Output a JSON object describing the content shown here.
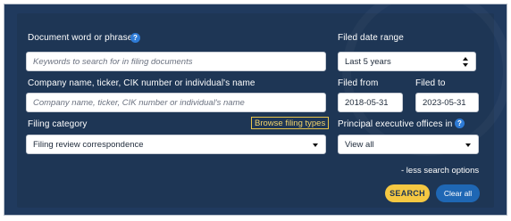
{
  "form": {
    "document_label": "Document word or phrase",
    "document_placeholder": "Keywords to search for in filing documents",
    "company_label": "Company name, ticker, CIK number or individual's name",
    "company_placeholder": "Company name, ticker, CIK number or individual's name",
    "category_label": "Filing category",
    "browse_label": "Browse filing types",
    "category_value": "Filing review correspondence",
    "date_range_label": "Filed date range",
    "date_range_value": "Last 5 years",
    "filed_from_label": "Filed from",
    "filed_from_value": "2018-05-31",
    "filed_to_label": "Filed to",
    "filed_to_value": "2023-05-31",
    "offices_label": "Principal executive offices in",
    "offices_value": "View all",
    "less_options": "- less search options",
    "search_button": "SEARCH",
    "clear_button": "Clear all",
    "help_glyph": "?"
  },
  "colors": {
    "panel": "#1e3655",
    "search_button": "#f5c842",
    "clear_button": "#1f67b4",
    "help_icon": "#2e7bd6",
    "browse_border": "#e9c54a"
  },
  "icons": [
    "help-icon",
    "dropdown-caret-icon",
    "sort-arrows-icon"
  ]
}
